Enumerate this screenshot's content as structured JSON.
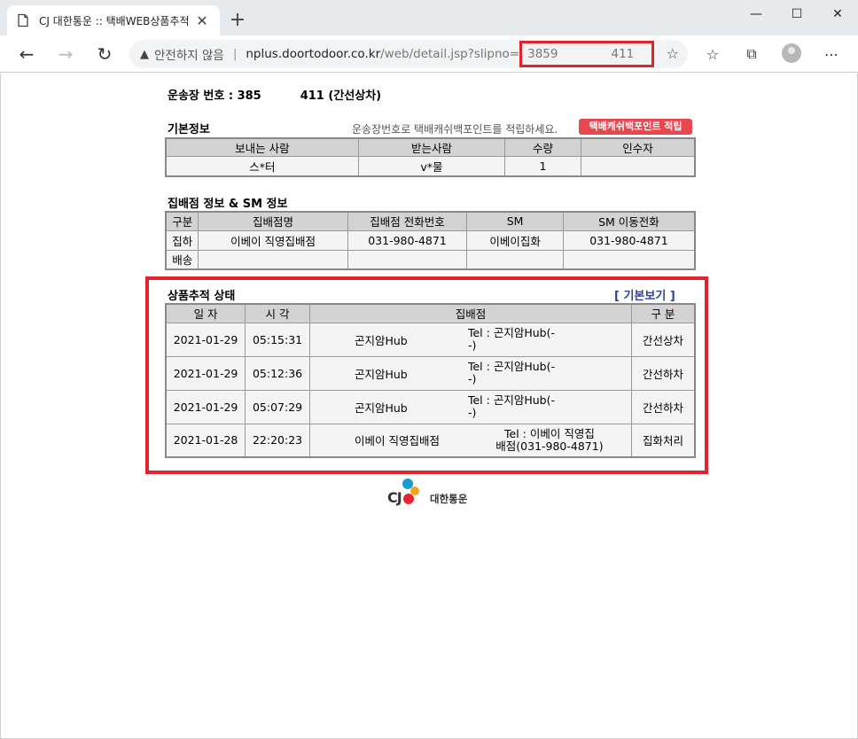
{
  "browser": {
    "tab_title": "CJ 대한통운 :: 택배WEB상품추적",
    "insecure_label": "안전하지 않음",
    "url_host": "nplus.doortodoor.co.kr",
    "url_path": "/web/detail.jsp?slipno=",
    "url_tail_a": "3859",
    "url_tail_b": "411"
  },
  "waybill": {
    "label": "운송장 번호 : 385",
    "tail": "411 (간선상차)"
  },
  "basic_info": {
    "title": "기본정보",
    "note": "운송장번호로 택배캐쉬백포인트를 적립하세요.",
    "point_button": "택배캐쉬백포인트 적립",
    "headers": [
      "보내는 사람",
      "받는사람",
      "수량",
      "인수자"
    ],
    "row": [
      "스*터",
      "v*물",
      "1",
      ""
    ]
  },
  "branch_info": {
    "title": "집배점 정보 & SM 정보",
    "headers": [
      "구분",
      "집배점명",
      "집배점 전화번호",
      "SM",
      "SM 이동전화"
    ],
    "rows": [
      [
        "집하",
        "이베이 직영집배점",
        "031-980-4871",
        "이베이집화",
        "031-980-4871"
      ],
      [
        "배송",
        "",
        "",
        "",
        ""
      ]
    ]
  },
  "tracking": {
    "title": "상품추적 상태",
    "basic_view": "[ 기본보기 ]",
    "headers": [
      "일 자",
      "시 각",
      "집배점",
      "구 분"
    ],
    "rows": [
      {
        "date": "2021-01-29",
        "time": "05:15:31",
        "location": "곤지암Hub",
        "tel": "Tel : 곤지암Hub(-",
        "tel2": "-)",
        "status": "간선상차"
      },
      {
        "date": "2021-01-29",
        "time": "05:12:36",
        "location": "곤지암Hub",
        "tel": "Tel : 곤지암Hub(-",
        "tel2": "-)",
        "status": "간선하차"
      },
      {
        "date": "2021-01-29",
        "time": "05:07:29",
        "location": "곤지암Hub",
        "tel": "Tel : 곤지암Hub(-",
        "tel2": "-)",
        "status": "간선하차"
      },
      {
        "date": "2021-01-28",
        "time": "22:20:23",
        "location": "이베이 직영집배점",
        "tel": "Tel : 이베이 직영집",
        "tel2": "배점(031-980-4871)",
        "status": "집화처리"
      }
    ]
  },
  "logo": {
    "mark": "CJ",
    "name": "대한통운",
    "colors": [
      "#1c9ad6",
      "#f7a21b",
      "#e6262e"
    ]
  }
}
